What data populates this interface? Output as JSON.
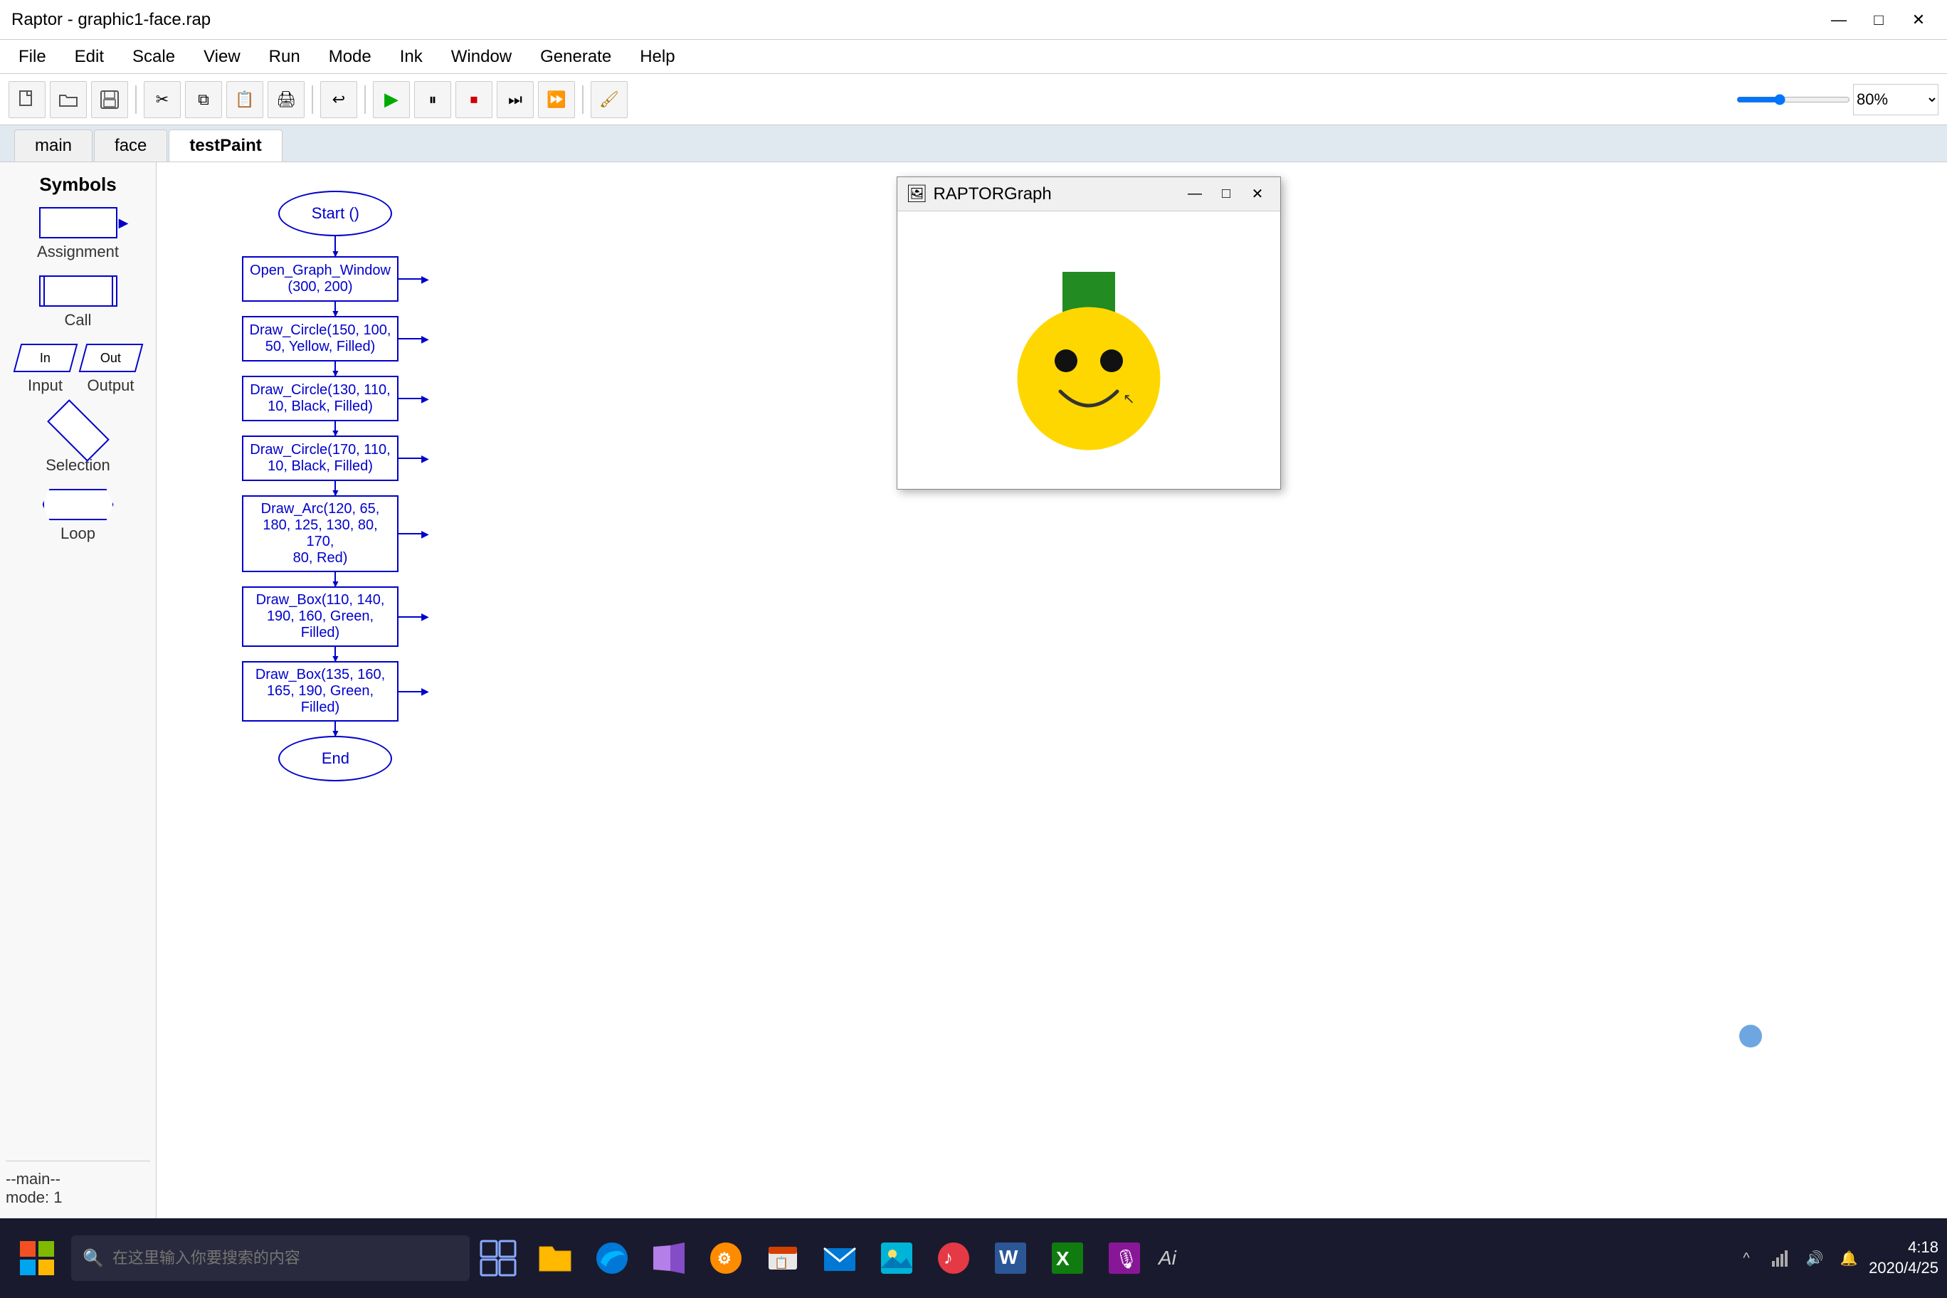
{
  "window": {
    "title": "Raptor - graphic1-face.rap",
    "controls": {
      "minimize": "—",
      "maximize": "□",
      "close": "✕"
    }
  },
  "menubar": {
    "items": [
      "File",
      "Edit",
      "Scale",
      "View",
      "Run",
      "Mode",
      "Ink",
      "Window",
      "Generate",
      "Help"
    ]
  },
  "toolbar": {
    "zoom_value": "80%",
    "zoom_placeholder": "80%"
  },
  "tabs": {
    "items": [
      {
        "label": "main",
        "active": false
      },
      {
        "label": "face",
        "active": false
      },
      {
        "label": "testPaint",
        "active": true
      }
    ]
  },
  "sidebar": {
    "title": "Symbols",
    "items": [
      {
        "label": "Assignment"
      },
      {
        "label": "Call"
      },
      {
        "label": "Input"
      },
      {
        "label": "Output"
      },
      {
        "label": "Selection"
      },
      {
        "label": "Loop"
      }
    ],
    "status": {
      "line1": "--main--",
      "line2": "mode: 1"
    }
  },
  "flowchart": {
    "start": "Start ()",
    "end": "End",
    "nodes": [
      {
        "text": "Open_Graph_Window\n(300, 200)"
      },
      {
        "text": "Draw_Circle(150, 100,\n50, Yellow, Filled)"
      },
      {
        "text": "Draw_Circle(130, 110,\n10, Black, Filled)"
      },
      {
        "text": "Draw_Circle(170, 110,\n10, Black, Filled)"
      },
      {
        "text": "Draw_Arc(120, 65,\n180, 125, 130, 80, 170,\n80, Red)"
      },
      {
        "text": "Draw_Box(110, 140,\n190, 160, Green,\nFilled)"
      },
      {
        "text": "Draw_Box(135, 160,\n165, 190, Green,\nFilled)"
      }
    ]
  },
  "raptor_graph": {
    "title": "RAPTORGraph",
    "icon": "🖼"
  },
  "taskbar": {
    "search_placeholder": "在这里输入你要搜索的内容",
    "clock": {
      "time": "4:18",
      "date": "2020/4/25"
    },
    "apps": [
      "taskview",
      "explorer",
      "edge",
      "visual-studio",
      "folder",
      "apps2",
      "mail",
      "photos",
      "apps3",
      "word",
      "apps4",
      "apps5",
      "apps6"
    ],
    "ai_label": "Ai"
  }
}
